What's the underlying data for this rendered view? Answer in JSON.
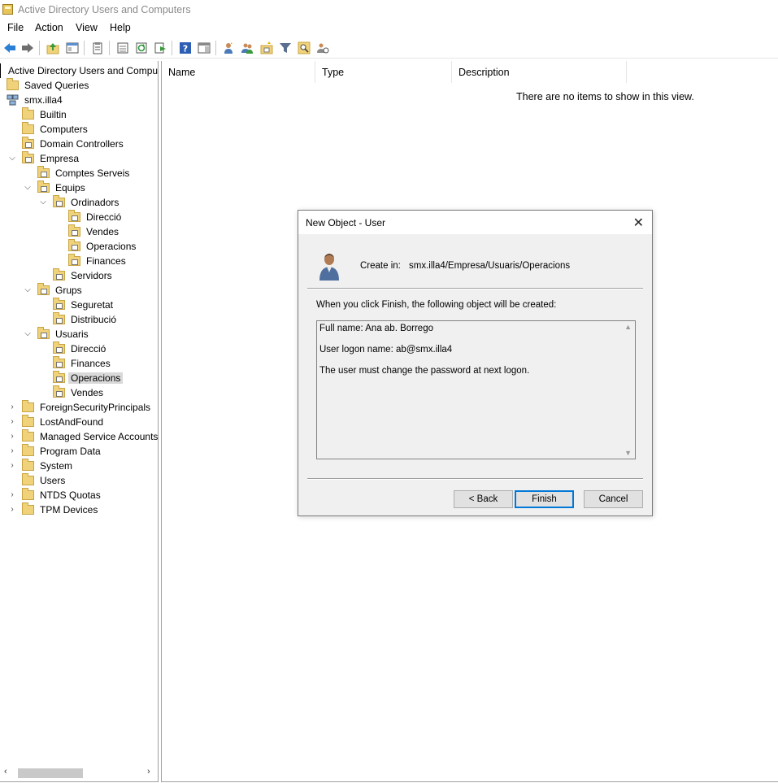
{
  "window": {
    "title": "Active Directory Users and Computers"
  },
  "menu": [
    "File",
    "Action",
    "View",
    "Help"
  ],
  "toolbar": {
    "icons": [
      "back-icon",
      "forward-icon",
      "up-folder-icon",
      "console-tree-icon",
      "properties-icon",
      "export-list-icon",
      "refresh-icon",
      "export-icon",
      "help-icon",
      "show-pane-icon",
      "new-user-icon",
      "new-group-icon",
      "new-ou-icon",
      "filter-icon",
      "find-icon",
      "delegate-icon"
    ]
  },
  "tree": {
    "root": "Active Directory Users and Computers",
    "saved_queries": "Saved Queries",
    "domain": "smx.illa4",
    "builtin": "Builtin",
    "computers": "Computers",
    "domain_controllers": "Domain Controllers",
    "empresa": "Empresa",
    "comptes_serveis": "Comptes Serveis",
    "equips": "Equips",
    "ordinadors": "Ordinadors",
    "ord_direccio": "Direcció",
    "ord_vendes": "Vendes",
    "ord_operacions": "Operacions",
    "ord_finances": "Finances",
    "servidors": "Servidors",
    "grups": "Grups",
    "seguretat": "Seguretat",
    "distribucio": "Distribució",
    "usuaris": "Usuaris",
    "usu_direccio": "Direcció",
    "usu_finances": "Finances",
    "usu_operacions": "Operacions",
    "usu_vendes": "Vendes",
    "foreign": "ForeignSecurityPrincipals",
    "lostandfound": "LostAndFound",
    "managed": "Managed Service Accounts",
    "program_data": "Program Data",
    "system": "System",
    "users": "Users",
    "ntds": "NTDS Quotas",
    "tpm": "TPM Devices"
  },
  "list": {
    "columns": [
      "Name",
      "Type",
      "Description"
    ],
    "empty_message": "There are no items to show in this view."
  },
  "dialog": {
    "title": "New Object - User",
    "create_in_label": "Create in:",
    "create_in_path": "smx.illa4/Empresa/Usuaris/Operacions",
    "info": "When you click Finish, the following object will be created:",
    "summary": [
      "Full name: Ana ab. Borrego",
      "User logon name: ab@smx.illa4",
      "The user must change the password at next logon."
    ],
    "buttons": {
      "back": "< Back",
      "finish": "Finish",
      "cancel": "Cancel"
    }
  },
  "colors": {
    "accent": "#0078d7",
    "folder": "#f0d27a",
    "selection": "#d9d9d9"
  }
}
